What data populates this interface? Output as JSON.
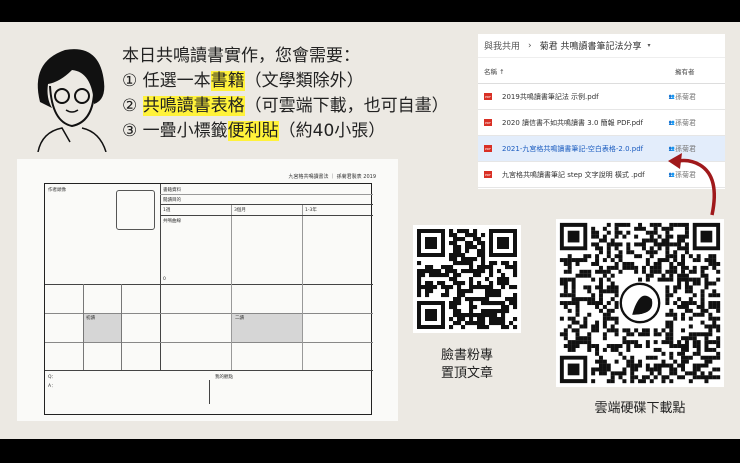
{
  "intro": {
    "title": "本日共鳴讀書實作，您會需要：",
    "items": [
      {
        "num": "①",
        "pre": "任選一本",
        "hl": "書籍",
        "post": "（文學類除外）"
      },
      {
        "num": "②",
        "pre": "",
        "hl": "共鳴讀書表格",
        "post": "（可雲端下載，也可自畫）"
      },
      {
        "num": "③",
        "pre": "一疊小標籤",
        "hl": "便利貼",
        "post": "（約40小張）"
      }
    ]
  },
  "sheet": {
    "header": "九宮格共鳴讀書法 ｜ 孫菊君製表 2019",
    "author": "作者頭像",
    "book": "書籍資料",
    "purpose": "閱讀目的",
    "t1": "1週",
    "t2": "3個月",
    "t3": "1-3年",
    "curve": "共鳴曲線",
    "zero": "0",
    "first": "初讀",
    "second": "二讀",
    "q": "Q：",
    "a": "A：",
    "view": "我的觀點"
  },
  "drive": {
    "crumb_root": "與我共用",
    "crumb_folder": "菊君 共鳴讀書筆記法分享",
    "col_name": "名稱 ↑",
    "col_owner": "擁有者",
    "files": [
      {
        "name": "2019共鳴讀書筆記法 示例.pdf",
        "owner": "孫菊君"
      },
      {
        "name": "2020 讀信書不如共鳴讀書 3.0 簡報 PDF.pdf",
        "owner": "孫菊君"
      },
      {
        "name": "2021-九宮格共鳴讀書筆記-空白表格-2.0.pdf",
        "owner": "孫菊君"
      },
      {
        "name": "九宮格共鳴讀書筆記 step 文字說明 橫式 .pdf",
        "owner": "孫菊君"
      }
    ]
  },
  "qr": {
    "fb_caption1": "臉書粉專",
    "fb_caption2": "置頂文章",
    "drive_caption": "雲端硬碟下載點"
  },
  "colors": {
    "highlight": "#fff23a",
    "arrow": "#a0191b",
    "selected": "#e3edfb"
  }
}
